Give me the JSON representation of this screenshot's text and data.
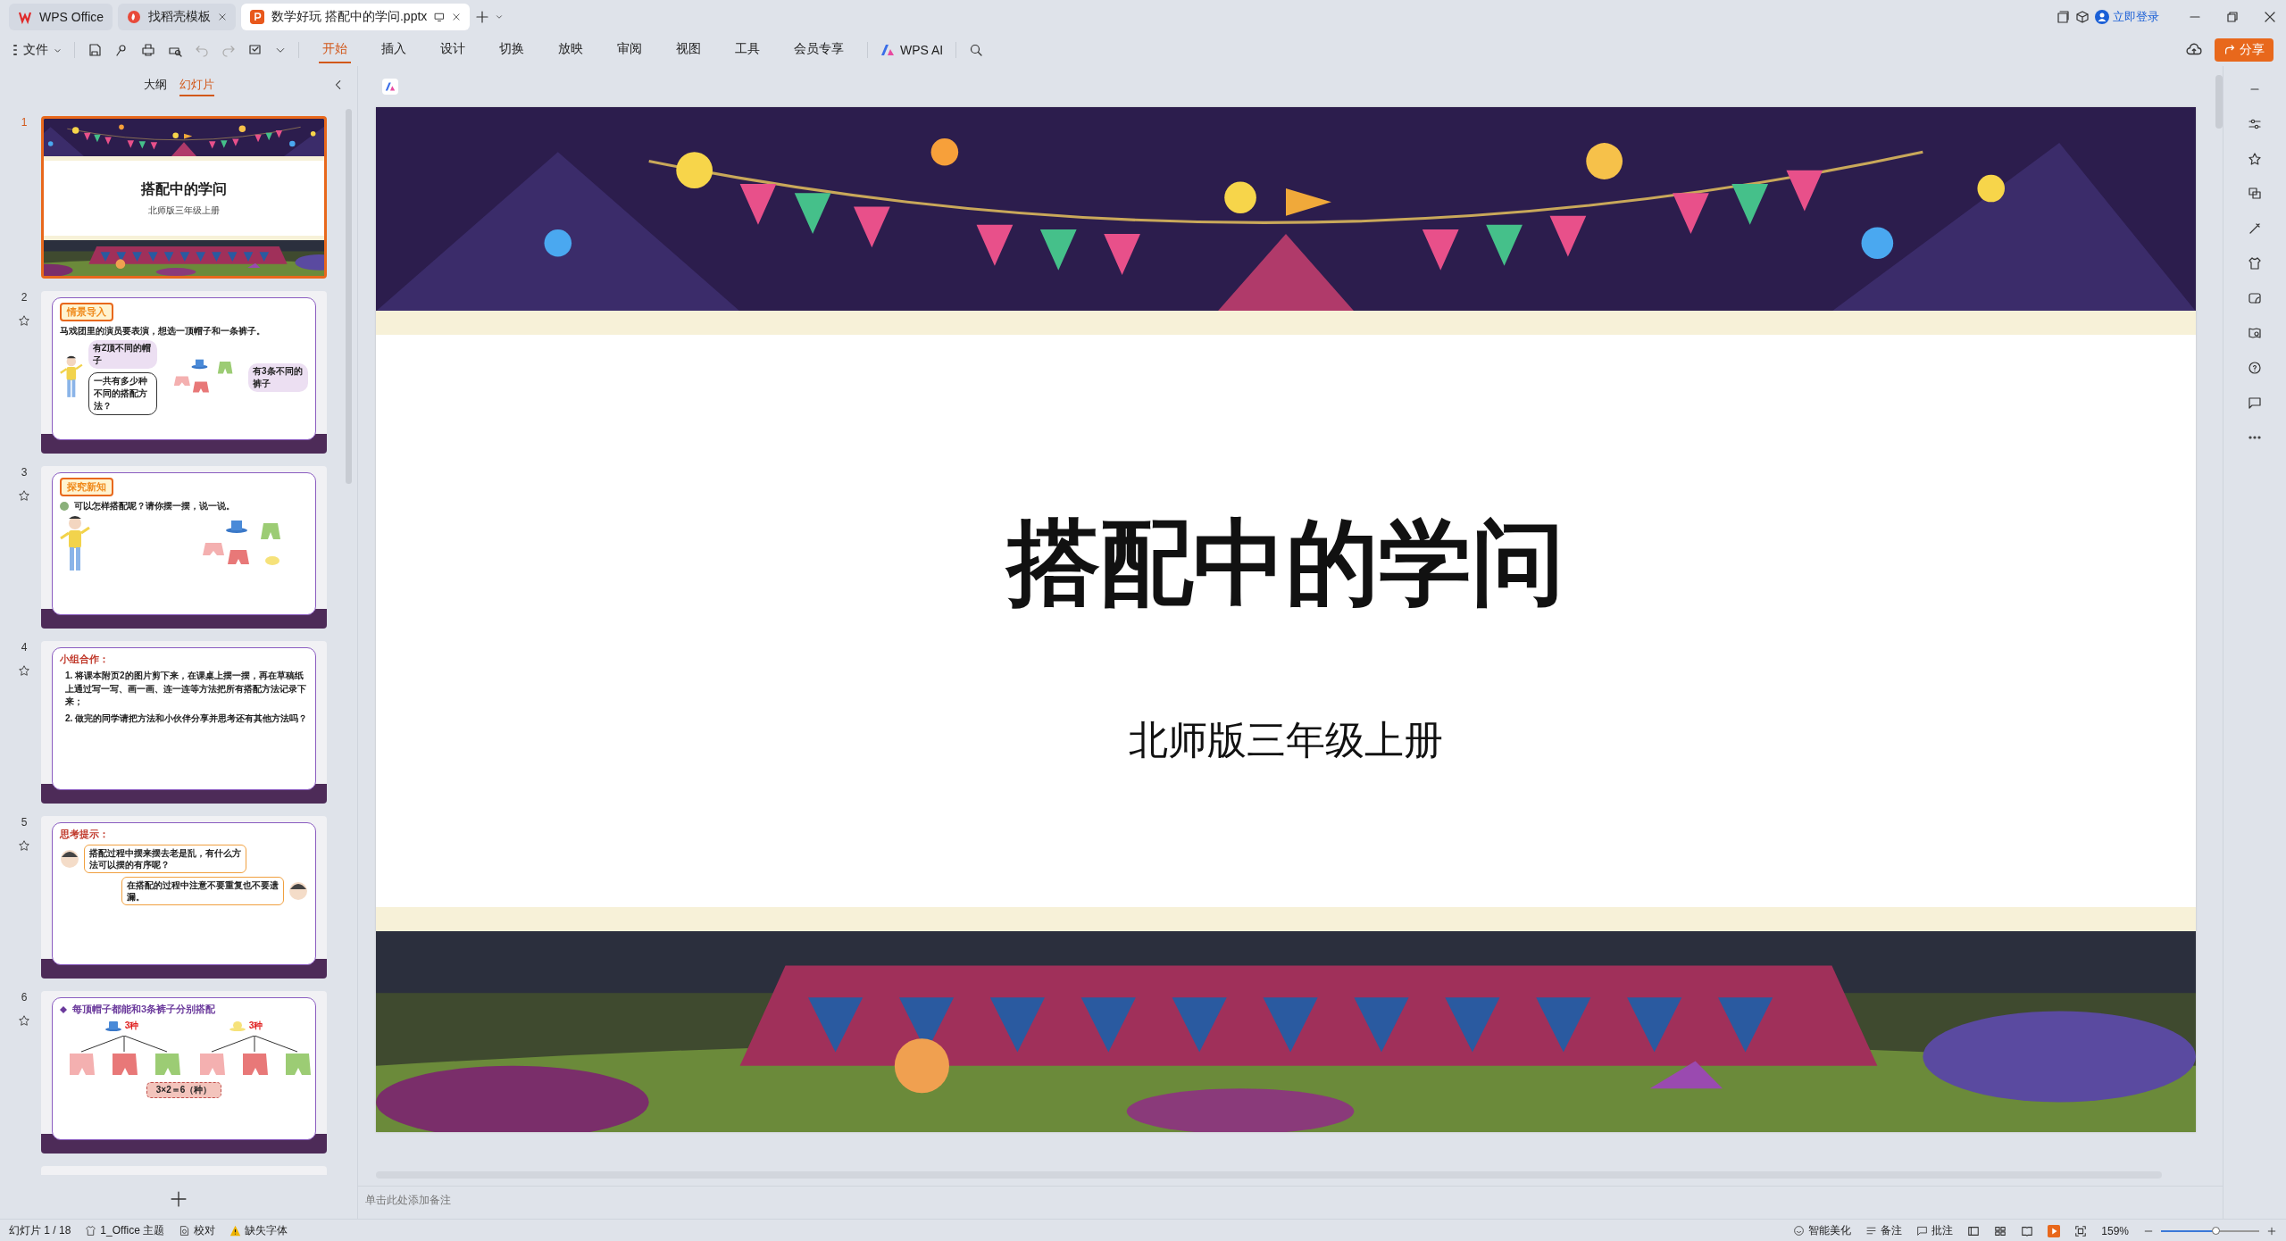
{
  "tabs": [
    {
      "label": "WPS Office",
      "kind": "home",
      "selected": false
    },
    {
      "label": "找稻壳模板",
      "kind": "template",
      "selected": false
    },
    {
      "label": "数学好玩 搭配中的学问.pptx",
      "kind": "presentation",
      "selected": true
    }
  ],
  "account": {
    "login": "立即登录"
  },
  "menu": {
    "file": "文件",
    "ribbon_tabs": [
      {
        "label": "开始",
        "selected": true
      },
      {
        "label": "插入",
        "selected": false
      },
      {
        "label": "设计",
        "selected": false
      },
      {
        "label": "切换",
        "selected": false
      },
      {
        "label": "放映",
        "selected": false
      },
      {
        "label": "审阅",
        "selected": false
      },
      {
        "label": "视图",
        "selected": false
      },
      {
        "label": "工具",
        "selected": false
      },
      {
        "label": "会员专享",
        "selected": false
      }
    ],
    "ai": "WPS AI",
    "share": "分享"
  },
  "slide_panel": {
    "view_tabs": [
      {
        "label": "大纲",
        "selected": false
      },
      {
        "label": "幻灯片",
        "selected": true
      }
    ],
    "slides": [
      {
        "number": "1",
        "kind": "title",
        "selected": true,
        "animated": false,
        "title": "搭配中的学问",
        "subtitle": "北师版三年级上册"
      },
      {
        "number": "2",
        "kind": "story",
        "selected": false,
        "animated": true,
        "badge": "情景导入",
        "text": "马戏团里的演员要表演，想选一顶帽子和一条裤子。",
        "bubbles": [
          "有2顶不同的帽子",
          "一共有多少种不同的搭配方法？",
          "有3条不同的裤子"
        ]
      },
      {
        "number": "3",
        "kind": "explore",
        "selected": false,
        "animated": true,
        "badge": "探究新知",
        "text": "可以怎样搭配呢？请你摆一摆，说一说。"
      },
      {
        "number": "4",
        "kind": "task",
        "selected": false,
        "animated": true,
        "heading": "小组合作：",
        "lines": [
          "1. 将课本附页2的图片剪下来，在课桌上摆一摆，再在草稿纸上通过写一写、画一画、连一连等方法把所有搭配方法记录下来；",
          "2. 做完的同学请把方法和小伙伴分享并思考还有其他方法吗？"
        ]
      },
      {
        "number": "5",
        "kind": "hint",
        "selected": false,
        "animated": true,
        "heading": "思考提示：",
        "bubbles": [
          "搭配过程中摆来摆去老是乱，有什么方法可以摆的有序呢？",
          "在搭配的过程中注意不要重复也不要遗漏。"
        ]
      },
      {
        "number": "6",
        "kind": "tree",
        "selected": false,
        "animated": true,
        "heading": "每顶帽子都能和3条裤子分别搭配",
        "counts": [
          "3种",
          "3种"
        ],
        "formula": "3×2＝6（种）"
      }
    ]
  },
  "slide": {
    "title": "搭配中的学问",
    "subtitle": "北师版三年级上册"
  },
  "notes": {
    "placeholder": "单击此处添加备注"
  },
  "status_bar": {
    "slide_count": "幻灯片 1 / 18",
    "theme": "1_Office 主题",
    "proofing": "校对",
    "missing_fonts": "缺失字体",
    "beautify": "智能美化",
    "notes": "备注",
    "comments": "批注",
    "zoom": "159%",
    "zoom_slider": {
      "level": 0.55
    }
  }
}
